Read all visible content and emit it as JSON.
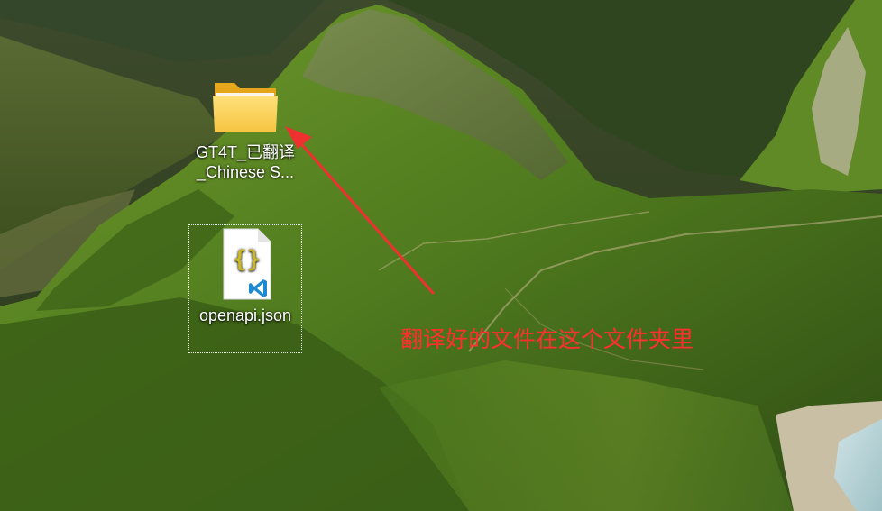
{
  "desktop": {
    "icons": [
      {
        "name": "GT4T_已翻译_Chinese S...",
        "type": "folder"
      },
      {
        "name": "openapi.json",
        "type": "json-file",
        "badge": "vscode-icon"
      }
    ]
  },
  "annotation": {
    "text": "翻译好的文件在这个文件夹里",
    "color": "#ff2f2f"
  },
  "wallpaper": {
    "description_colors": [
      "#4f7a20",
      "#2f4a16",
      "#7b8c5a",
      "#b7b19a"
    ]
  }
}
